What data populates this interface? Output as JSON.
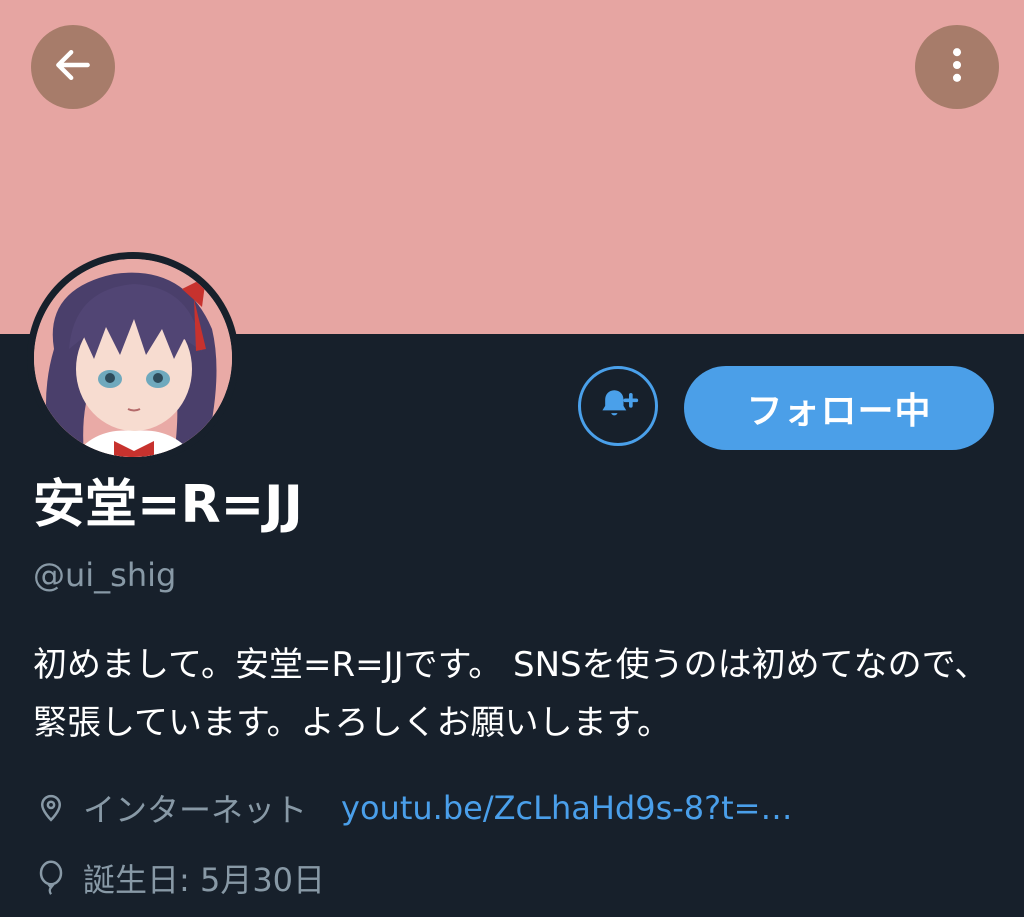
{
  "profile": {
    "display_name": "安堂=R=JJ",
    "handle": "@ui_shig",
    "bio": "初めまして。安堂=R=JJです。 SNSを使うのは初めてなので、緊張しています。よろしくお願いします。",
    "location": "インターネット",
    "link": "youtu.be/ZcLhaHd9s-8?t=…",
    "birthday": "誕生日: 5月30日"
  },
  "actions": {
    "follow_label": "フォロー中"
  },
  "icons": {
    "back": "back-arrow-icon",
    "more": "more-vertical-icon",
    "notify": "bell-plus-icon",
    "location": "location-pin-icon",
    "birthday": "balloon-icon"
  },
  "colors": {
    "banner": "#e6a5a2",
    "background": "#17202b",
    "accent": "#4b9fe8",
    "muted_text": "#8899a6",
    "icon_button": "#a77c6a"
  }
}
